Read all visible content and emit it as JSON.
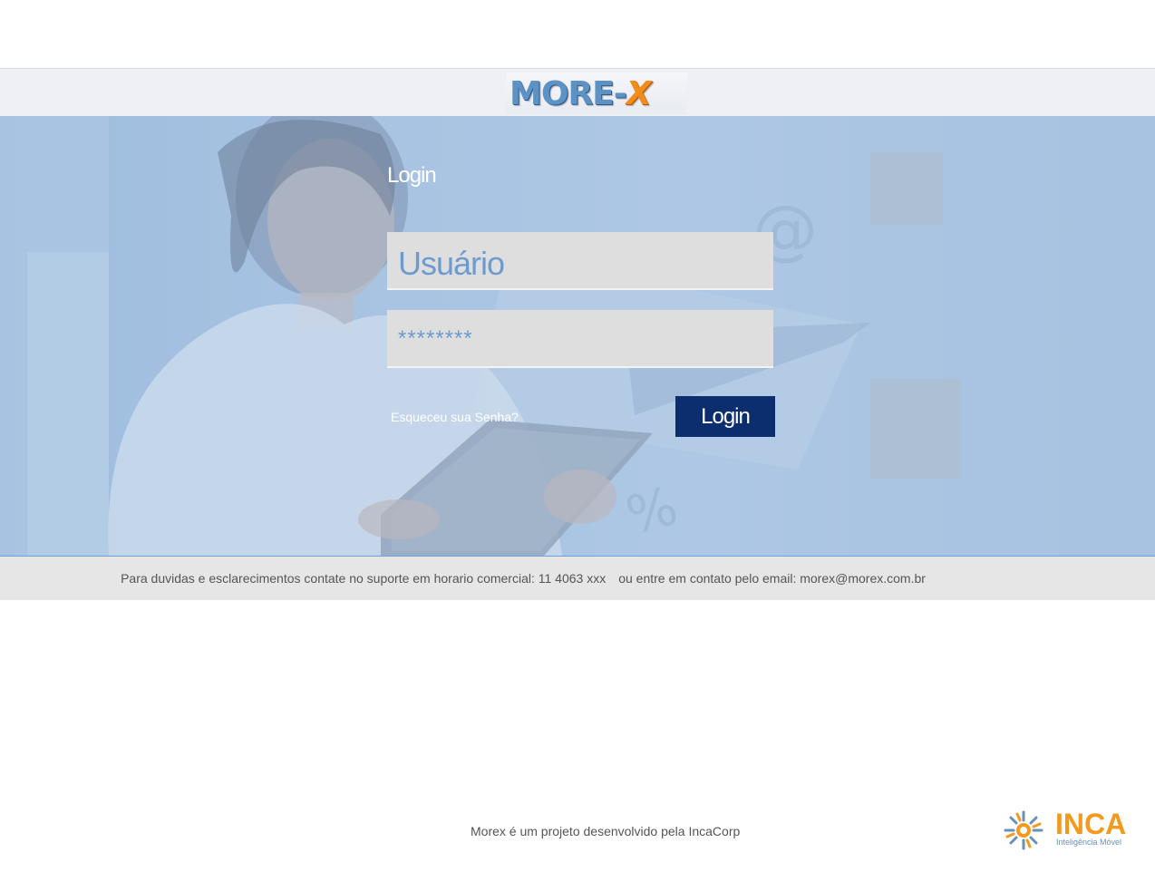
{
  "header": {
    "logo_main": "MORE",
    "logo_separator": "-",
    "logo_accent": "X"
  },
  "login": {
    "title": "Login",
    "username_placeholder": "Usuário",
    "password_value": "********",
    "forgot_label": "Esqueceu sua Senha?",
    "button_label": "Login"
  },
  "support": {
    "phone_text": "Para duvidas e esclarecimentos contate no suporte em horario comercial: 11 4063 xxx",
    "email_text": "ou entre em contato pelo email: morex@morex.com.br"
  },
  "footer": {
    "credit": "Morex é um projeto desenvolvido pela IncaCorp",
    "partner_name": "INCA",
    "partner_tagline": "Inteligência Móvel"
  },
  "colors": {
    "accent_blue": "#0c2e6e",
    "hero_blue": "#adc7e4",
    "field_text": "#6d9bd0",
    "brand_orange": "#f39a1e"
  }
}
